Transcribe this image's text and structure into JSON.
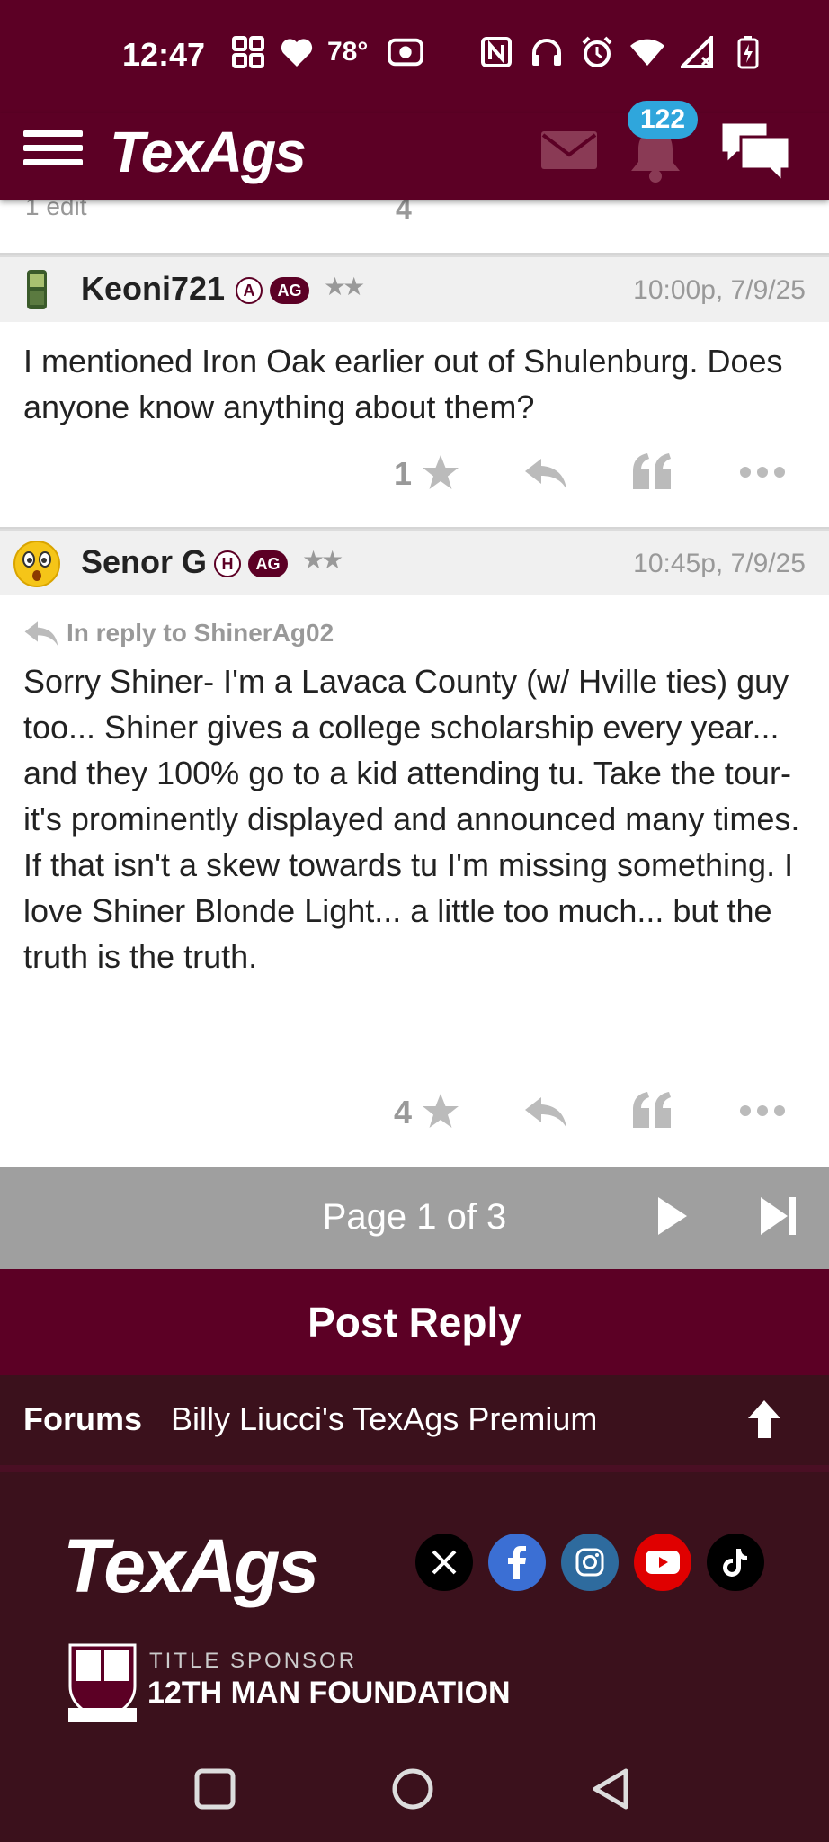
{
  "status_bar": {
    "time": "12:47",
    "temperature": "78°"
  },
  "app_header": {
    "logo": "TexAgs",
    "notification_count": "122"
  },
  "previous_post": {
    "edit_note": "1 edit",
    "star_count": "4"
  },
  "posts": [
    {
      "username": "Keoni721",
      "rank_letter": "A",
      "ag_badge": "AG",
      "stars": "★★",
      "timestamp": "10:00p, 7/9/25",
      "body": "I mentioned Iron Oak earlier out of Shulenburg. Does anyone know anything about them?",
      "star_count": "1"
    },
    {
      "username": "Senor G",
      "rank_letter": "H",
      "ag_badge": "AG",
      "stars": "★★",
      "timestamp": "10:45p, 7/9/25",
      "reply_to": "In reply to ShinerAg02",
      "body": "Sorry Shiner- I'm a Lavaca County (w/ Hville ties) guy too... Shiner gives a college scholarship every year... and they 100% go to a kid attending tu. Take the tour- it's prominently displayed and announced many times. If that isn't a skew towards tu I'm missing something. I love Shiner Blonde Light... a little too much... but the truth is the truth.",
      "star_count": "4"
    }
  ],
  "pagination": {
    "label": "Page 1 of 3"
  },
  "post_reply": {
    "label": "Post Reply"
  },
  "breadcrumb": {
    "forums": "Forums",
    "board": "Billy Liucci's TexAgs Premium"
  },
  "footer": {
    "logo": "TexAgs",
    "sponsor_label": "TITLE SPONSOR",
    "sponsor_name": "12TH MAN FOUNDATION",
    "social": [
      "x-icon",
      "facebook-icon",
      "instagram-icon",
      "youtube-icon",
      "tiktok-icon"
    ]
  },
  "colors": {
    "brand_maroon": "#5c0025",
    "footer_dark": "#3b111c",
    "pager_gray": "#9f9f9f",
    "badge_blue": "#2fa6dc"
  }
}
